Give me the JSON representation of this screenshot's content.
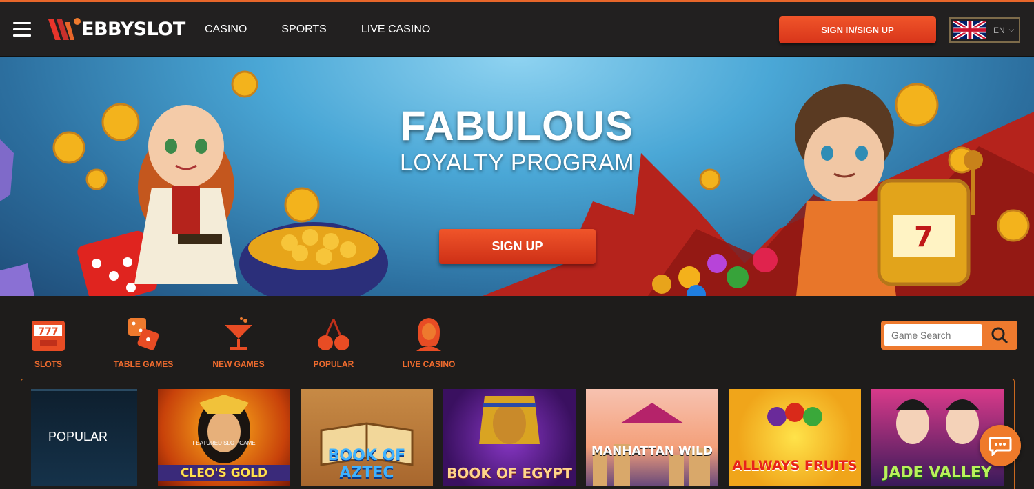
{
  "header": {
    "logo_text": "EBBYSLOT",
    "nav": [
      "CASINO",
      "SPORTS",
      "LIVE CASINO"
    ],
    "signin_label": "SIGN IN/SIGN UP",
    "lang_code": "EN",
    "accent": "#e8662a"
  },
  "hero": {
    "title": "FABULOUS",
    "subtitle": "LOYALTY PROGRAM",
    "button_label": "SIGN UP"
  },
  "categories": [
    {
      "label": "SLOTS",
      "icon": "slot-machine-icon"
    },
    {
      "label": "TABLE GAMES",
      "icon": "dice-icon"
    },
    {
      "label": "NEW GAMES",
      "icon": "cocktail-icon"
    },
    {
      "label": "POPULAR",
      "icon": "cherries-icon"
    },
    {
      "label": "LIVE CASINO",
      "icon": "dealer-icon"
    }
  ],
  "search": {
    "placeholder": "Game Search"
  },
  "games": {
    "section_label": "POPULAR",
    "tiles": [
      {
        "name": "CLEO'S GOLD",
        "tag": "FEATURED SLOT GAME"
      },
      {
        "name": "BOOK OF AZTEC"
      },
      {
        "name": "BOOK OF EGYPT"
      },
      {
        "name": "MANHATTAN WILD"
      },
      {
        "name": "ALLWAYS FRUITS"
      },
      {
        "name": "JADE VALLEY"
      }
    ]
  }
}
